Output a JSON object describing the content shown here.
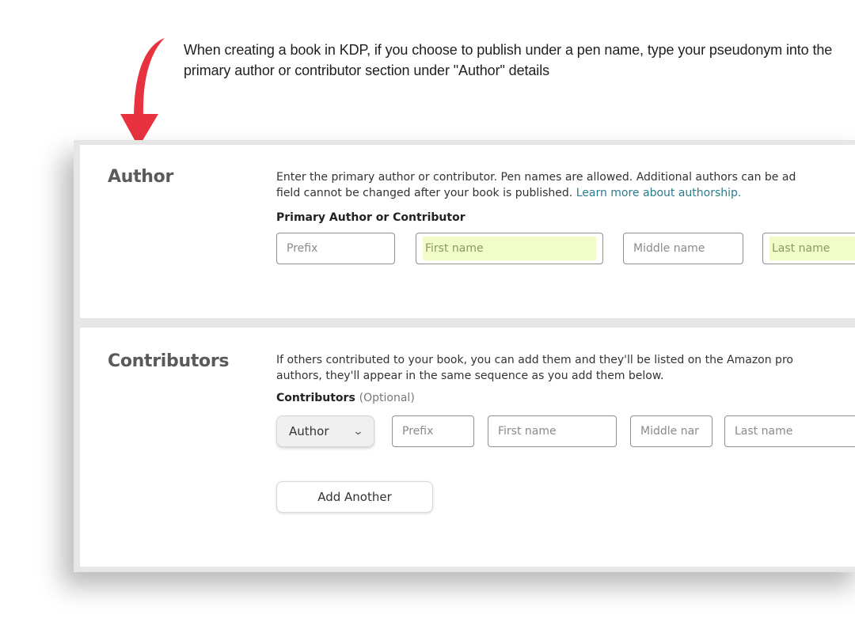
{
  "annotation": {
    "caption": "When creating a book in KDP, if you choose to publish under a pen name, type your pseudonym into the primary author or contributor section under \"Author\" details",
    "arrow_color": "#e8323f"
  },
  "author_section": {
    "title": "Author",
    "description_line1": "Enter the primary author or contributor. Pen names are allowed. Additional authors can be ad",
    "description_line2_prefix": "field cannot be changed after your book is published. ",
    "learn_more_link": "Learn more about authorship.",
    "field_label": "Primary Author or Contributor",
    "fields": {
      "prefix": {
        "placeholder": "Prefix",
        "value": ""
      },
      "first_name": {
        "placeholder": "First name",
        "value": "",
        "highlighted": true
      },
      "middle_name": {
        "placeholder": "Middle name",
        "value": ""
      },
      "last_name": {
        "placeholder": "Last name",
        "value": "",
        "highlighted": true
      }
    },
    "highlight_color": "#f1fcc6"
  },
  "contributors_section": {
    "title": "Contributors",
    "description_line1": "If others contributed to your book, you can add them and they'll be listed on the Amazon pro",
    "description_line2": "authors, they'll appear in the same sequence as you add them below.",
    "field_label": "Contributors",
    "field_label_optional": "(Optional)",
    "role_select": {
      "selected": "Author"
    },
    "fields": {
      "prefix": {
        "placeholder": "Prefix",
        "value": ""
      },
      "first_name": {
        "placeholder": "First name",
        "value": ""
      },
      "middle_name": {
        "placeholder": "Middle nar",
        "value": ""
      },
      "last_name": {
        "placeholder": "Last name",
        "value": ""
      }
    },
    "add_another_label": "Add Another"
  },
  "colors": {
    "link": "#2d7a8c",
    "section_title": "#5a5a5a"
  }
}
